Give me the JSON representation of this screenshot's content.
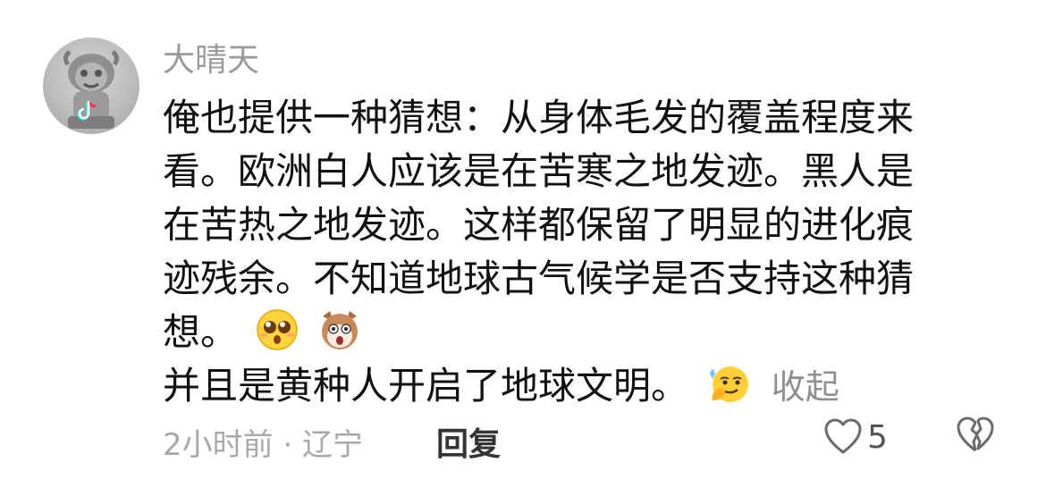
{
  "comment": {
    "username": "大晴天",
    "avatar_icon": "stone-lion-avatar",
    "body_lines": [
      "俺也提供一种猜想：从身体毛发的覆盖程度来",
      "看。欧洲白人应该是在苦寒之地发迹。黑人是",
      "在苦热之地发迹。这样都保留了明显的进化痕",
      "迹残余。不知道地球古气候学是否支持这种猜",
      "想。",
      "并且是黄种人开启了地球文明。"
    ],
    "emojis": [
      "pleading-face-emoji",
      "surprised-dog-emoji",
      "smirk-thinking-emoji"
    ],
    "collapse_label": "收起",
    "timestamp": "2小时前 · 辽宁",
    "reply_label": "回复",
    "like_count": "5",
    "colors": {
      "username": "#9a9a9a",
      "text": "#111111",
      "meta": "#a8a8a8",
      "icon": "#6b6b6b"
    }
  }
}
